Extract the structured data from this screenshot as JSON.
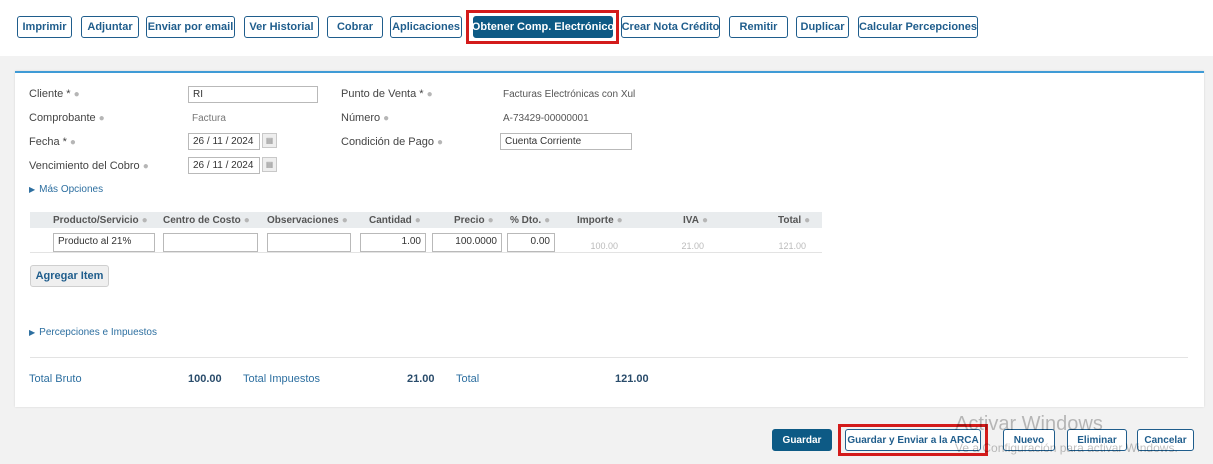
{
  "toolbar": {
    "buttons": [
      "Imprimir",
      "Adjuntar",
      "Enviar por email",
      "Ver Historial",
      "Cobrar",
      "Aplicaciones",
      "Obtener Comp. Electrónico",
      "Crear Nota Crédito",
      "Remitir",
      "Duplicar",
      "Calcular Percepciones"
    ]
  },
  "form": {
    "cliente_label": "Cliente *",
    "cliente_value": "RI",
    "comprobante_label": "Comprobante",
    "comprobante_value": "Factura",
    "fecha_label": "Fecha *",
    "fecha_value": "26 / 11 /  2024",
    "vencimiento_label": "Vencimiento del Cobro",
    "vencimiento_value": "26 / 11 /  2024",
    "punto_venta_label": "Punto de Venta *",
    "punto_venta_value": "Facturas Electrónicas con Xul",
    "numero_label": "Número",
    "numero_value": "A-73429-00000001",
    "condicion_label": "Condición de Pago",
    "condicion_value": "Cuenta Corriente",
    "mas_opciones": "Más Opciones"
  },
  "items_table": {
    "headers": [
      "Producto/Servicio",
      "Centro de Costo",
      "Observaciones",
      "Cantidad",
      "Precio",
      "% Dto.",
      "Importe",
      "IVA",
      "Total"
    ],
    "row": {
      "producto": "Producto al 21%",
      "centro_costo": "",
      "observaciones": "",
      "cantidad": "1.00",
      "precio": "100.0000",
      "dto": "0.00",
      "importe": "100.00",
      "iva": "21.00",
      "total": "121.00"
    }
  },
  "agregar_item": "Agregar Item",
  "percepciones": "Percepciones e Impuestos",
  "totals": {
    "bruto_label": "Total Bruto",
    "bruto_value": "100.00",
    "impuestos_label": "Total Impuestos",
    "impuestos_value": "21.00",
    "total_label": "Total",
    "total_value": "121.00"
  },
  "footer": {
    "guardar": "Guardar",
    "guardar_enviar": "Guardar y Enviar a la ARCA",
    "nuevo": "Nuevo",
    "eliminar": "Eliminar",
    "cancelar": "Cancelar"
  },
  "watermark": {
    "line1": "Activar Windows",
    "line2": "Ve a Configuración para activar Windows."
  },
  "colors": {
    "accent": "#1f5d8c",
    "primary_button": "#0d5a85",
    "highlight_box": "#d31b1b",
    "panel_top_border": "#3f9bd6"
  }
}
